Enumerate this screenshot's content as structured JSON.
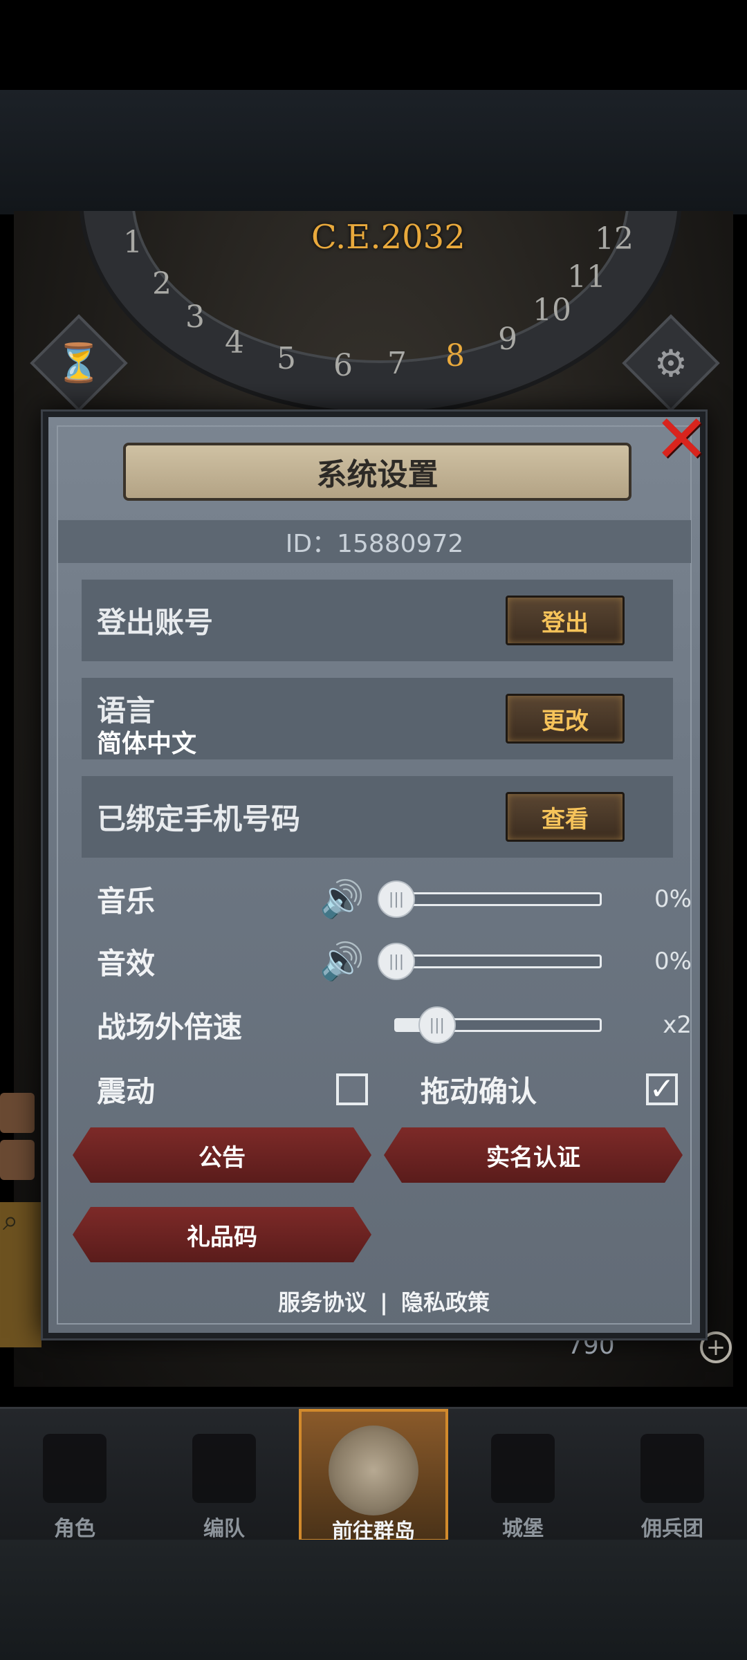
{
  "background": {
    "era_label": "C.E.2032",
    "dial_numbers": [
      "1",
      "2",
      "3",
      "4",
      "5",
      "6",
      "7",
      "8",
      "9",
      "10",
      "11",
      "12"
    ],
    "active_month": "8",
    "hourglass_icon": "hourglass-icon",
    "gear_icon": "gear-icon",
    "resource_count": "790"
  },
  "modal": {
    "title": "系统设置",
    "id_label": "ID：15880972",
    "logout": {
      "label": "登出账号",
      "button": "登出"
    },
    "language": {
      "label": "语言",
      "value": "简体中文",
      "button": "更改"
    },
    "phone": {
      "label": "已绑定手机号码",
      "button": "查看"
    },
    "music": {
      "label": "音乐",
      "percent_text": "0%",
      "value": 0
    },
    "sfx": {
      "label": "音效",
      "percent_text": "0%",
      "value": 0
    },
    "speed": {
      "label": "战场外倍速",
      "value_text": "x2",
      "value": 0.2
    },
    "vibration": {
      "label": "震动",
      "checked": false
    },
    "drag_confirm": {
      "label": "拖动确认",
      "checked": true
    },
    "buttons": {
      "notice": "公告",
      "realname": "实名认证",
      "gift_code": "礼品码"
    },
    "footer": {
      "service": "服务协议",
      "separator": "|",
      "privacy": "隐私政策"
    }
  },
  "nav": [
    {
      "label": "角色",
      "icon": "knight-icon",
      "active": false
    },
    {
      "label": "编队",
      "icon": "helmet-icon",
      "active": false
    },
    {
      "label": "前往群岛",
      "icon": "globe-icon",
      "active": true
    },
    {
      "label": "城堡",
      "icon": "castle-icon",
      "active": false
    },
    {
      "label": "佣兵团",
      "icon": "mercenary-icon",
      "active": false
    }
  ],
  "colors": {
    "accent_gold": "#f6c35a",
    "close_red": "#d9241d",
    "modal_bg": "#6c7682"
  }
}
